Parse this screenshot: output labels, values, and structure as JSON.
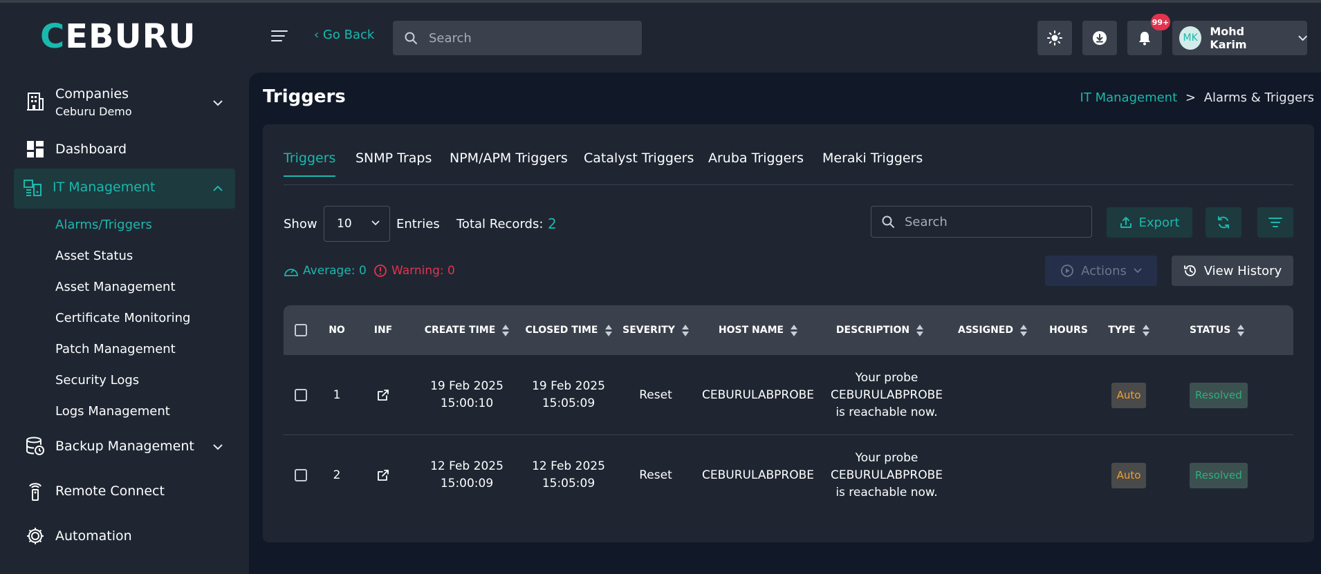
{
  "brand": {
    "logo": "CEBURU",
    "logo_first": "C",
    "logo_rest": "EBURU"
  },
  "header": {
    "go_back": "‹ Go Back",
    "search_placeholder": "Search",
    "notif_badge": "99+",
    "user_initials": "MK",
    "user_name": "Mohd Karim"
  },
  "sidebar": {
    "companies_label": "Companies",
    "companies_sub": "Ceburu Demo",
    "dashboard": "Dashboard",
    "it_management": "IT Management",
    "it_sub": [
      "Alarms/Triggers",
      "Asset Status",
      "Asset Management",
      "Certificate Monitoring",
      "Patch Management",
      "Security Logs",
      "Logs Management"
    ],
    "backup": "Backup Management",
    "remote": "Remote Connect",
    "automation": "Automation"
  },
  "page": {
    "title": "Triggers",
    "breadcrumb_link": "IT Management",
    "breadcrumb_sep": ">",
    "breadcrumb_current": "Alarms & Triggers"
  },
  "tabs": [
    "Triggers",
    "SNMP Traps",
    "NPM/APM Triggers",
    "Catalyst Triggers",
    "Aruba Triggers",
    "Meraki Triggers"
  ],
  "controls": {
    "show": "Show",
    "entries_value": "10",
    "entries": "Entries",
    "total_label": "Total Records:",
    "total_value": "2",
    "search_placeholder": "Search",
    "export": "Export",
    "average": "Average: 0",
    "warning": "Warning: 0",
    "actions": "Actions",
    "view_history": "View History"
  },
  "table": {
    "headers": [
      "NO",
      "INF",
      "CREATE TIME",
      "CLOSED TIME",
      "SEVERITY",
      "HOST NAME",
      "DESCRIPTION",
      "ASSIGNED",
      "HOURS",
      "TYPE",
      "STATUS"
    ],
    "rows": [
      {
        "no": "1",
        "create_date": "19 Feb 2025",
        "create_time": "15:00:10",
        "closed_date": "19 Feb 2025",
        "closed_time": "15:05:09",
        "severity": "Reset",
        "host": "CEBURULABPROBE",
        "desc1": "Your probe",
        "desc2": "CEBURULABPROBE",
        "desc3": "is reachable now.",
        "assigned": "",
        "hours": "",
        "type": "Auto",
        "status": "Resolved"
      },
      {
        "no": "2",
        "create_date": "12 Feb 2025",
        "create_time": "15:00:09",
        "closed_date": "12 Feb 2025",
        "closed_time": "15:05:09",
        "severity": "Reset",
        "host": "CEBURULABPROBE",
        "desc1": "Your probe",
        "desc2": "CEBURULABPROBE",
        "desc3": "is reachable now.",
        "assigned": "",
        "hours": "",
        "type": "Auto",
        "status": "Resolved"
      }
    ]
  },
  "colors": {
    "accent": "#1bb8ad",
    "warning": "#e5334e",
    "bg": "#1f2632",
    "main_bg": "#111827"
  }
}
